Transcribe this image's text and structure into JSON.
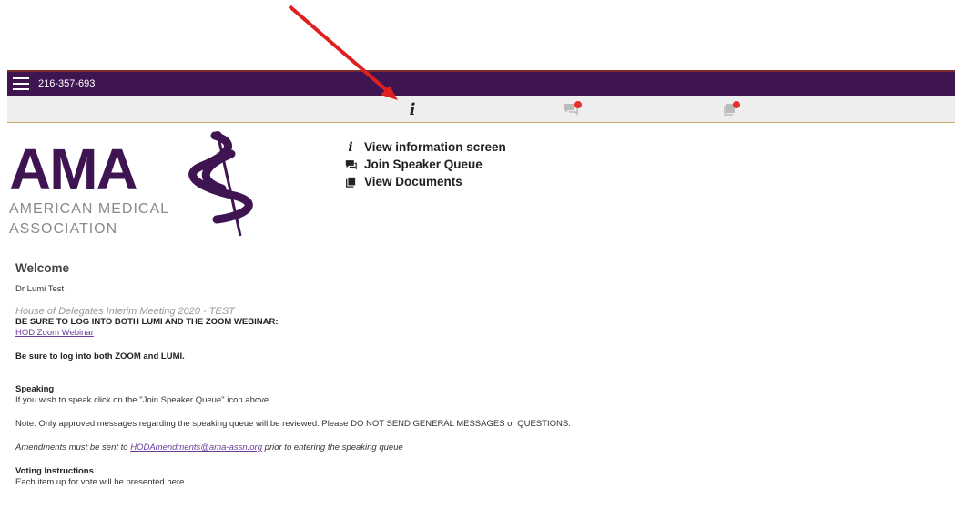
{
  "header": {
    "meeting_id": "216-357-693"
  },
  "tabs": [
    {
      "name": "info",
      "icon": "info-icon"
    },
    {
      "name": "chat",
      "icon": "chat-bubble-icon",
      "badge": true
    },
    {
      "name": "docs",
      "icon": "documents-icon",
      "badge": true
    }
  ],
  "logo": {
    "big": "AMA",
    "line1": "AMERICAN MEDICAL",
    "line2": "ASSOCIATION"
  },
  "actions": {
    "info": "View information screen",
    "queue": "Join Speaker Queue",
    "docs": "View Documents"
  },
  "content": {
    "welcome": "Welcome",
    "user": "Dr Lumi Test",
    "meeting": "House of Delegates Interim Meeting 2020 - TEST",
    "login_both": "BE SURE TO LOG INTO BOTH LUMI AND THE ZOOM WEBINAR:",
    "zoom_link": "HOD Zoom Webinar",
    "be_sure": "Be sure to log into both ZOOM and LUMI.",
    "speaking_title": "Speaking",
    "speaking_text": "If you wish to speak click on the \"Join Speaker Queue\" icon above.",
    "note": "Note: Only approved messages regarding the speaking queue will be reviewed. Please DO NOT SEND GENERAL MESSAGES or QUESTIONS.",
    "amend_pre": "Amendments must be sent to ",
    "amend_email": "HODAmendments@ama-assn.org",
    "amend_post": " prior to entering the speaking queue",
    "voting_title": "Voting Instructions",
    "voting_text": "Each item up for vote will be presented here."
  },
  "colors": {
    "topbar": "#3f1551",
    "logo_purple": "#3f1551",
    "badge": "#e53030",
    "arrow": "#e02020"
  }
}
